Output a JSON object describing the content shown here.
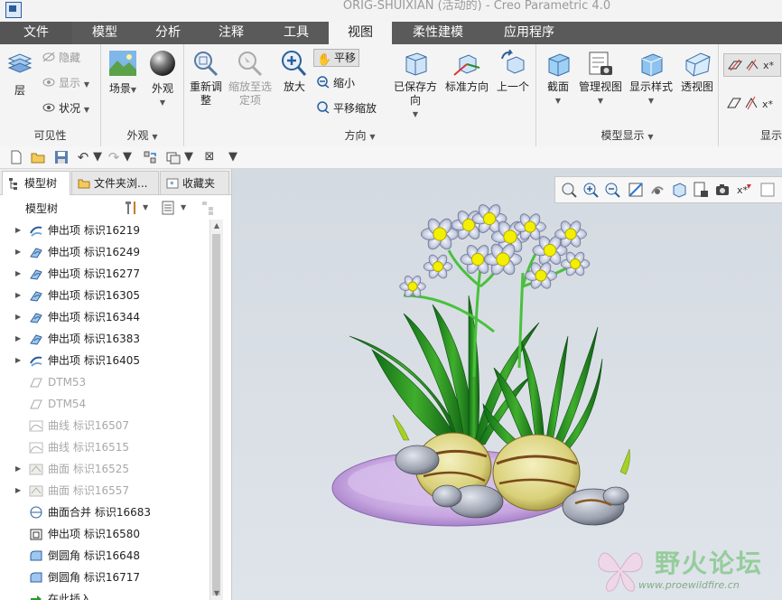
{
  "window": {
    "title": "ORIG-SHUIXIAN (活动的) - Creo Parametric 4.0"
  },
  "ribbon_tabs": [
    {
      "label": "文件"
    },
    {
      "label": "模型"
    },
    {
      "label": "分析"
    },
    {
      "label": "注释"
    },
    {
      "label": "工具"
    },
    {
      "label": "视图"
    },
    {
      "label": "柔性建模"
    },
    {
      "label": "应用程序"
    }
  ],
  "active_tab": "视图",
  "ribbon": {
    "visibility": {
      "group_label": "可见性",
      "layer_label": "层",
      "hide_label": "隐藏",
      "show_label": "显示",
      "status_label": "状况"
    },
    "appearance": {
      "group_label": "外观",
      "scene_label": "场景",
      "appearance_label": "外观"
    },
    "orientation": {
      "group_label": "方向",
      "refit_label": "重新调整",
      "zoom_to_selected_label": "缩放至选定项",
      "zoom_in_label": "放大",
      "pan_label": "平移",
      "zoom_out_label": "缩小",
      "pan_zoom_label": "平移缩放",
      "saved_orientations_label": "已保存方向",
      "standard_orientation_label": "标准方向",
      "previous_label": "上一个"
    },
    "model_display": {
      "group_label": "模型显示",
      "section_label": "截面",
      "manage_views_label": "管理视图",
      "display_style_label": "显示样式",
      "perspective_label": "透视图"
    },
    "show": {
      "group_label": "显示"
    }
  },
  "panel": {
    "tabs": [
      {
        "label": "模型树"
      },
      {
        "label": "文件夹浏..."
      },
      {
        "label": "收藏夹"
      }
    ],
    "tree_header": "模型树",
    "tree_items": [
      {
        "label": "伸出项 标识16219",
        "icon": "sweep-protrusion-icon",
        "expandable": true,
        "dimmed": false
      },
      {
        "label": "伸出项 标识16249",
        "icon": "protrusion-icon",
        "expandable": true,
        "dimmed": false
      },
      {
        "label": "伸出项 标识16277",
        "icon": "protrusion-icon",
        "expandable": true,
        "dimmed": false
      },
      {
        "label": "伸出项 标识16305",
        "icon": "protrusion-icon",
        "expandable": true,
        "dimmed": false
      },
      {
        "label": "伸出项 标识16344",
        "icon": "protrusion-icon",
        "expandable": true,
        "dimmed": false
      },
      {
        "label": "伸出项 标识16383",
        "icon": "protrusion-icon",
        "expandable": true,
        "dimmed": false
      },
      {
        "label": "伸出项 标识16405",
        "icon": "sweep-protrusion-icon",
        "expandable": true,
        "dimmed": false
      },
      {
        "label": "DTM53",
        "icon": "datum-plane-icon",
        "expandable": false,
        "dimmed": true
      },
      {
        "label": "DTM54",
        "icon": "datum-plane-icon",
        "expandable": false,
        "dimmed": true
      },
      {
        "label": "曲线 标识16507",
        "icon": "curve-icon",
        "expandable": false,
        "dimmed": true
      },
      {
        "label": "曲线 标识16515",
        "icon": "curve-icon",
        "expandable": false,
        "dimmed": true
      },
      {
        "label": "曲面 标识16525",
        "icon": "surface-icon",
        "expandable": true,
        "dimmed": true
      },
      {
        "label": "曲面 标识16557",
        "icon": "surface-icon",
        "expandable": true,
        "dimmed": true
      },
      {
        "label": "曲面合并 标识16683",
        "icon": "surface-merge-icon",
        "expandable": false,
        "dimmed": false
      },
      {
        "label": "伸出项 标识16580",
        "icon": "shell-protrusion-icon",
        "expandable": false,
        "dimmed": false
      },
      {
        "label": "倒圆角 标识16648",
        "icon": "round-icon",
        "expandable": false,
        "dimmed": false
      },
      {
        "label": "倒圆角 标识16717",
        "icon": "round-icon",
        "expandable": false,
        "dimmed": false
      },
      {
        "label": "在此插入",
        "icon": "insert-here-arrow-icon",
        "expandable": false,
        "dimmed": false
      }
    ]
  },
  "watermark": {
    "cn": "野火论坛",
    "url": "www.proewildfire.cn"
  },
  "colors": {
    "tab_bar": "#5a5a5a",
    "ribbon_bg": "#f4f4f4",
    "graphics_bg": "#d9dee4",
    "leaf_green": "#1f8a1f",
    "flower_petal": "#c8d2ea",
    "flower_center": "#f2f000",
    "dish_purple": "#c7a6e0",
    "bulb_yellow": "#e2dc8c"
  }
}
